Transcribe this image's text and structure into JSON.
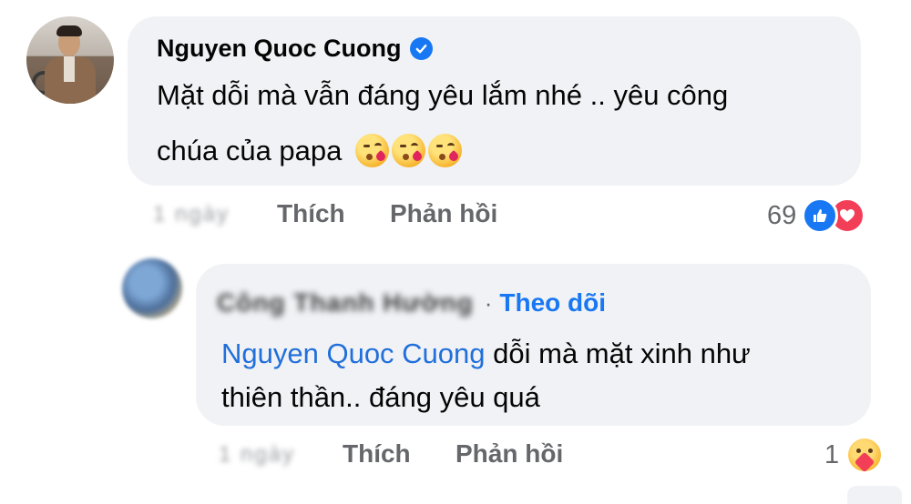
{
  "comment1": {
    "author": "Nguyen Quoc Cuong",
    "verified_icon": "verified-badge-icon",
    "text_line1": "Mặt dỗi mà vẫn đáng yêu lắm nhé .. yêu công",
    "text_line2": "chúa của papa",
    "emojis": [
      "kissing-heart-emoji",
      "kissing-heart-emoji",
      "kissing-heart-emoji"
    ],
    "time_blurred": "1 ngày",
    "like_label": "Thích",
    "reply_label": "Phản hồi",
    "reaction_count": "69",
    "reaction_icons": [
      "like-icon",
      "love-icon"
    ]
  },
  "comment2": {
    "author_blurred": "Công Thanh Hường",
    "follow_label": "Theo dõi",
    "mention": "Nguyen Quoc Cuong",
    "text_after_mention": " dỗi mà mặt xinh như",
    "text_line2": "thiên thần.. đáng yêu quá",
    "time_blurred": "1 ngày",
    "like_label": "Thích",
    "reply_label": "Phản hồi",
    "reaction_count": "1",
    "reaction_icons": [
      "care-icon"
    ]
  },
  "colors": {
    "bubble": "#f0f2f5",
    "link_blue": "#1877f2",
    "secondary_text": "#65676b",
    "love_red": "#f33e58"
  }
}
